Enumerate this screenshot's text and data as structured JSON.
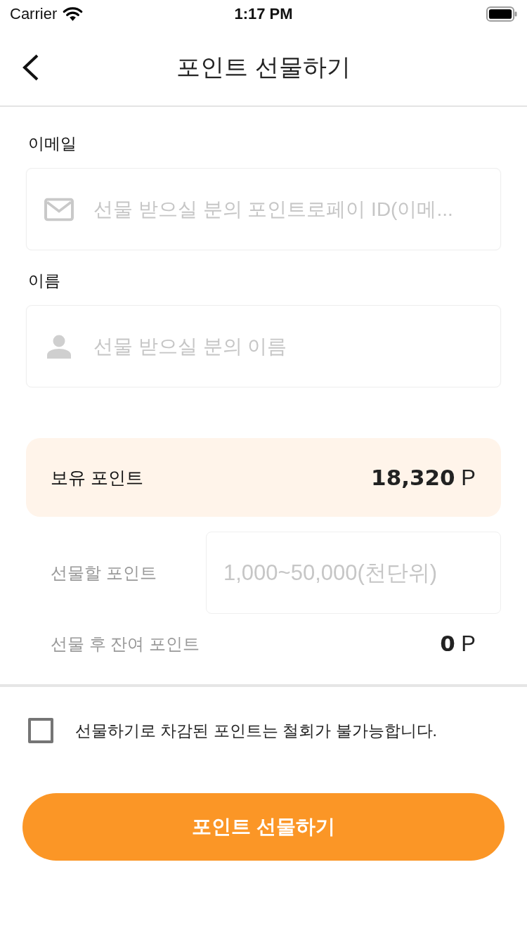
{
  "status_bar": {
    "carrier": "Carrier",
    "time": "1:17 PM"
  },
  "nav": {
    "title": "포인트 선물하기"
  },
  "fields": [
    {
      "label": "이메일",
      "kind": "email",
      "placeholder": "선물 받으실 분의 포인트로페이 ID(이메..."
    },
    {
      "label": "이름",
      "kind": "person",
      "placeholder": "선물 받으실 분의 이름"
    }
  ],
  "balance": {
    "label": "보유 포인트",
    "amount": "18,320",
    "unit": "P"
  },
  "gift": {
    "label": "선물할 포인트",
    "placeholder": "1,000~50,000(천단위)"
  },
  "remaining": {
    "label": "선물 후 잔여 포인트",
    "amount": "0",
    "unit": "P"
  },
  "agreement": {
    "text": "선물하기로 차감된 포인트는 철회가 불가능합니다.",
    "checked": false
  },
  "submit": {
    "label": "포인트 선물하기"
  }
}
